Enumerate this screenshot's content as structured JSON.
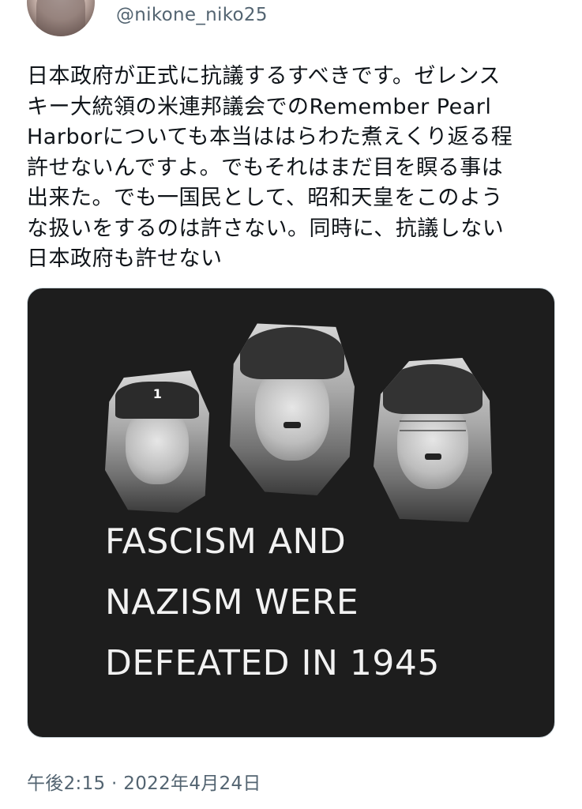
{
  "tweet": {
    "handle": "@nikone_niko25",
    "avatar_icon": "avatar-photo",
    "text": "日本政府が正式に抗議するすべきです。ゼレンス\nキー大統領の米連邦議会でのRemember Pearl\nHarborについても本当ははらわた煮えくり返る程\n許せないんですよ。でもそれはまだ目を瞑る事は\n出来た。でも一国民として、昭和天皇をこのよう\nな扱いをするのは許さない。同時に、抗議しない\n日本政府も許せない",
    "timestamp": "午後2:15 · 2022年4月24日"
  },
  "media": {
    "background_color": "#1d1d1d",
    "caption_lines": [
      "FASCISM AND",
      "NAZISM WERE",
      "DEFEATED IN 1945"
    ],
    "cap_badge": "1"
  }
}
